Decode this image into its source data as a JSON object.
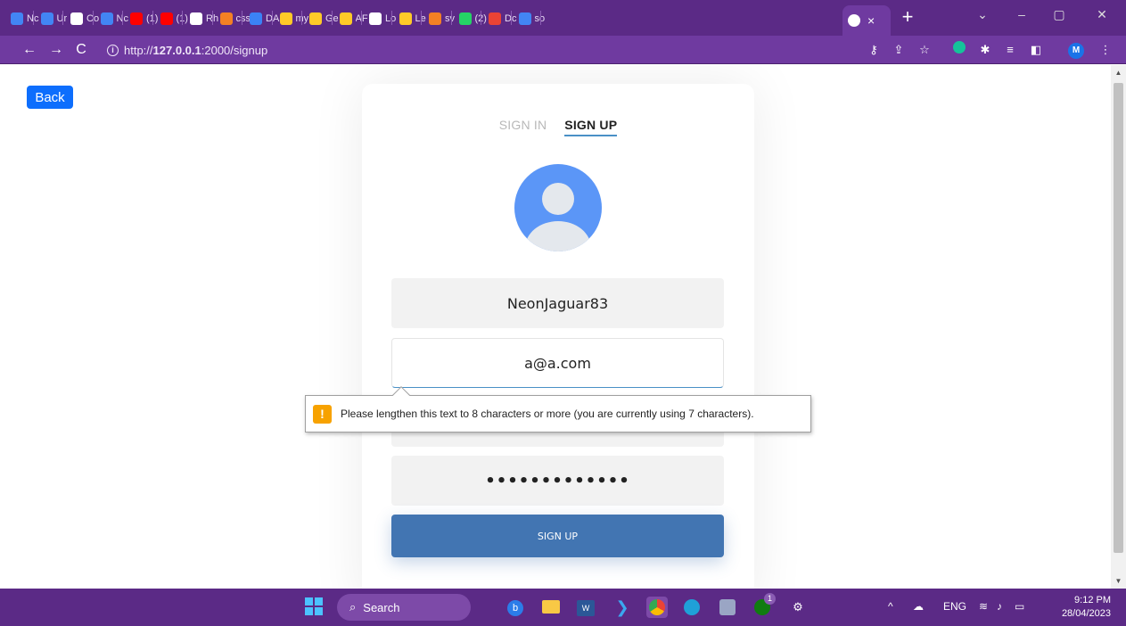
{
  "browser": {
    "tabs": [
      {
        "label": "Nc",
        "icon": "docs-icon",
        "color": "#4285f4"
      },
      {
        "label": "Ur",
        "icon": "docs-icon",
        "color": "#4285f4"
      },
      {
        "label": "Co",
        "icon": "github-icon",
        "color": "#ffffff"
      },
      {
        "label": "Nc",
        "icon": "docs-icon",
        "color": "#4285f4"
      },
      {
        "label": "(1)",
        "icon": "youtube-icon",
        "color": "#ff0000"
      },
      {
        "label": "(1)",
        "icon": "youtube-icon",
        "color": "#ff0000"
      },
      {
        "label": "Rh",
        "icon": "app-icon",
        "color": "#ffffff"
      },
      {
        "label": "css",
        "icon": "stackoverflow-icon",
        "color": "#f48024"
      },
      {
        "label": "DA",
        "icon": "s-icon",
        "color": "#3b82f6"
      },
      {
        "label": "my",
        "icon": "firebase-icon",
        "color": "#ffca28"
      },
      {
        "label": "Ge",
        "icon": "firebase-icon",
        "color": "#ffca28"
      },
      {
        "label": "AF",
        "icon": "firebase-icon",
        "color": "#ffca28"
      },
      {
        "label": "Lo",
        "icon": "globe-icon",
        "color": "#ffffff"
      },
      {
        "label": "Le",
        "icon": "firebase-icon",
        "color": "#ffca28"
      },
      {
        "label": "sv",
        "icon": "stackoverflow-icon",
        "color": "#f48024"
      },
      {
        "label": "(2)",
        "icon": "whatsapp-icon",
        "color": "#25d366"
      },
      {
        "label": "Dc",
        "icon": "gmail-icon",
        "color": "#ea4335"
      },
      {
        "label": "so",
        "icon": "docs-icon",
        "color": "#4285f4"
      }
    ],
    "active_tab_close": "×",
    "new_tab": "+",
    "url_prefix": "http://",
    "url_host": "127.0.0.1",
    "url_path": ":2000/signup",
    "profile_initial": "M"
  },
  "page": {
    "back_label": "Back",
    "tab_signin": "SIGN IN",
    "tab_signup": "SIGN UP",
    "username_value": "NeonJaguar83",
    "email_value": "a@a.com",
    "password_value": "•••••••••••••",
    "signup_button": "SIGN UP",
    "validation_message": "Please lengthen this text to 8 characters or more (you are currently using 7 characters).",
    "validation_icon": "!"
  },
  "taskbar": {
    "search_label": "Search",
    "language": "ENG",
    "time": "9:12 PM",
    "date": "28/04/2023",
    "xbox_badge": "1"
  },
  "colors": {
    "browser_frame": "#5b2a86",
    "primary_button": "#0d6efd",
    "signup_button": "#4275b2",
    "avatar": "#5b96f7",
    "warning": "#f7a200"
  }
}
